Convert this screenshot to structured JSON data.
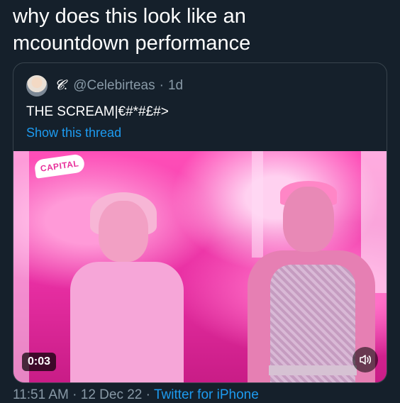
{
  "tweet": {
    "text": "why does this look like an\nmcountdown performance"
  },
  "quote": {
    "display_name": "𝓒.",
    "handle": "@Celebirteas",
    "separator": "·",
    "age": "1d",
    "text": "THE SCREAM|€#*#£#>",
    "show_thread": "Show this thread"
  },
  "media": {
    "logo_text": "CAPITAL",
    "duration": "0:03",
    "volume_icon": "speaker-icon"
  },
  "footer": {
    "time": "11:51 AM",
    "sep1": " · ",
    "date": "12 Dec 22",
    "sep2": " · ",
    "source": "Twitter for iPhone"
  },
  "colors": {
    "background": "#15202b",
    "link": "#1d9bf0",
    "muted": "#8899a6",
    "border": "#38444d"
  }
}
